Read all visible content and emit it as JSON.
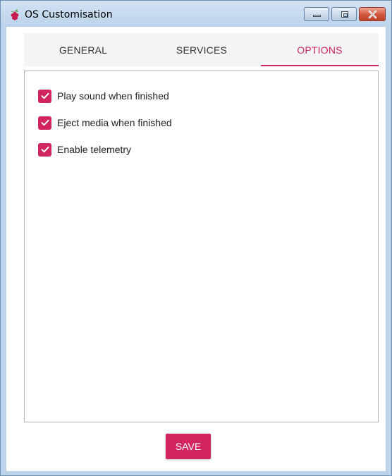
{
  "window": {
    "title": "OS Customisation",
    "app_icon": "raspberry-pi-icon",
    "controls": [
      "minimize-icon",
      "maximize-icon",
      "close-icon"
    ]
  },
  "tabs": [
    {
      "label": "GENERAL",
      "active": false
    },
    {
      "label": "SERVICES",
      "active": false
    },
    {
      "label": "OPTIONS",
      "active": true
    }
  ],
  "options": [
    {
      "label": "Play sound when finished",
      "checked": true
    },
    {
      "label": "Eject media when finished",
      "checked": true
    },
    {
      "label": "Enable telemetry",
      "checked": true
    }
  ],
  "footer": {
    "save_label": "SAVE"
  },
  "colors": {
    "accent": "#d2255d",
    "titlebar": "#bcd3ea",
    "close_button": "#c8472e"
  }
}
